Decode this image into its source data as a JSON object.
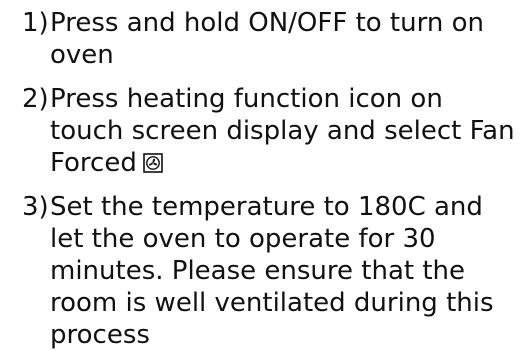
{
  "steps": [
    {
      "number": "1)",
      "text": "Press and hold ON/OFF to turn on oven"
    },
    {
      "number": "2)",
      "text": "Press heating function icon on touch screen display and select Fan Forced",
      "icon": "fan-forced-icon"
    },
    {
      "number": "3)",
      "text": "Set the temperature to 180C and let the oven to operate for 30 minutes. Please ensure that the room is well ventilated during this process"
    }
  ]
}
